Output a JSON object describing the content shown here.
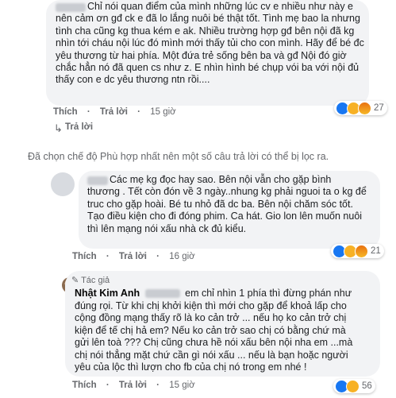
{
  "comment1": {
    "text": "Chỉ nói quan điểm của mình những lúc cv e nhiều như này e\nnên cảm ơn gđ ck e đã lo lắng nuôi bé thật tốt. Tình mẹ bao la nhưng\ntình cha cũng kg thua kém e ak. Nhiều trường hợp gđ bên nội đã kg\nnhìn tới cháu nội lúc đó mình mới thấy tủi cho con mình. Hãy để bé đc\nyêu thương từ hai phía. Một đứa trẻ sống bên ba và gđ Nội đó giờ\nchắc hẳn nó đã quen cs như z. E nhìn hình bé chụp vói ba với nội đủ\nthấy con e dc yêu thương ntn rồi....",
    "actions": [
      "Thích",
      "Trả lời"
    ],
    "time": "15 giờ",
    "reaction_count": "27"
  },
  "reply_link": "Trả lời",
  "notice": "Đã chọn chế độ Phù hợp nhất nên một số câu trả lời có thể bị lọc ra.",
  "comment2": {
    "text": "Các mẹ kg đọc hay sao. Bên nội vẫn cho gặp bình\nthương . Tết còn đón về 3 ngày..nhung kg phải nguoi ta o kg để\ntruc cho gặp hoài. Bé tu nhỏ đã dc ba. Bên nội chăm sóc tốt.\nTạo điều kiện cho đi đóng phim. Ca hát. Gio lon lên muốn nuôi\nthì lên mạng nói xấu nhà ck đủ kiểu.",
    "actions": [
      "Thích",
      "Trả lời"
    ],
    "time": "16 giờ",
    "reaction_count": "21"
  },
  "comment3": {
    "author_badge": "Tác giả",
    "author": "Nhật Kim Anh",
    "text_first": "em chỉ nhìn 1 phía thì đừng phán như",
    "text": "đúng rọi. Từ khi chị khởi kiện thì mới cho gặp để khoả lấp cho\ncộng đồng mạng thấy rõ là ko cản trở ... nếu họ ko cản trở chị\nkiện để tế chị hả em? Nếu ko cản trở sao chị có bằng chứ mà\ngửi lên toà ??? Chị cũng chưa hề nói xấu bên nội nha em ...mà\nchị nói thẳng mặt chứ cần gì nói xấu ... nếu là bạn hoặc người\nyêu của lộc thì lượn cho fb của chị nó trong em nhé !",
    "actions": [
      "Thích",
      "Trả lời"
    ],
    "time": "15 giờ",
    "reaction_count": "56"
  },
  "colors": {
    "bubble": "#f2f3f5",
    "meta": "#65676b",
    "like": "#1877f2"
  }
}
